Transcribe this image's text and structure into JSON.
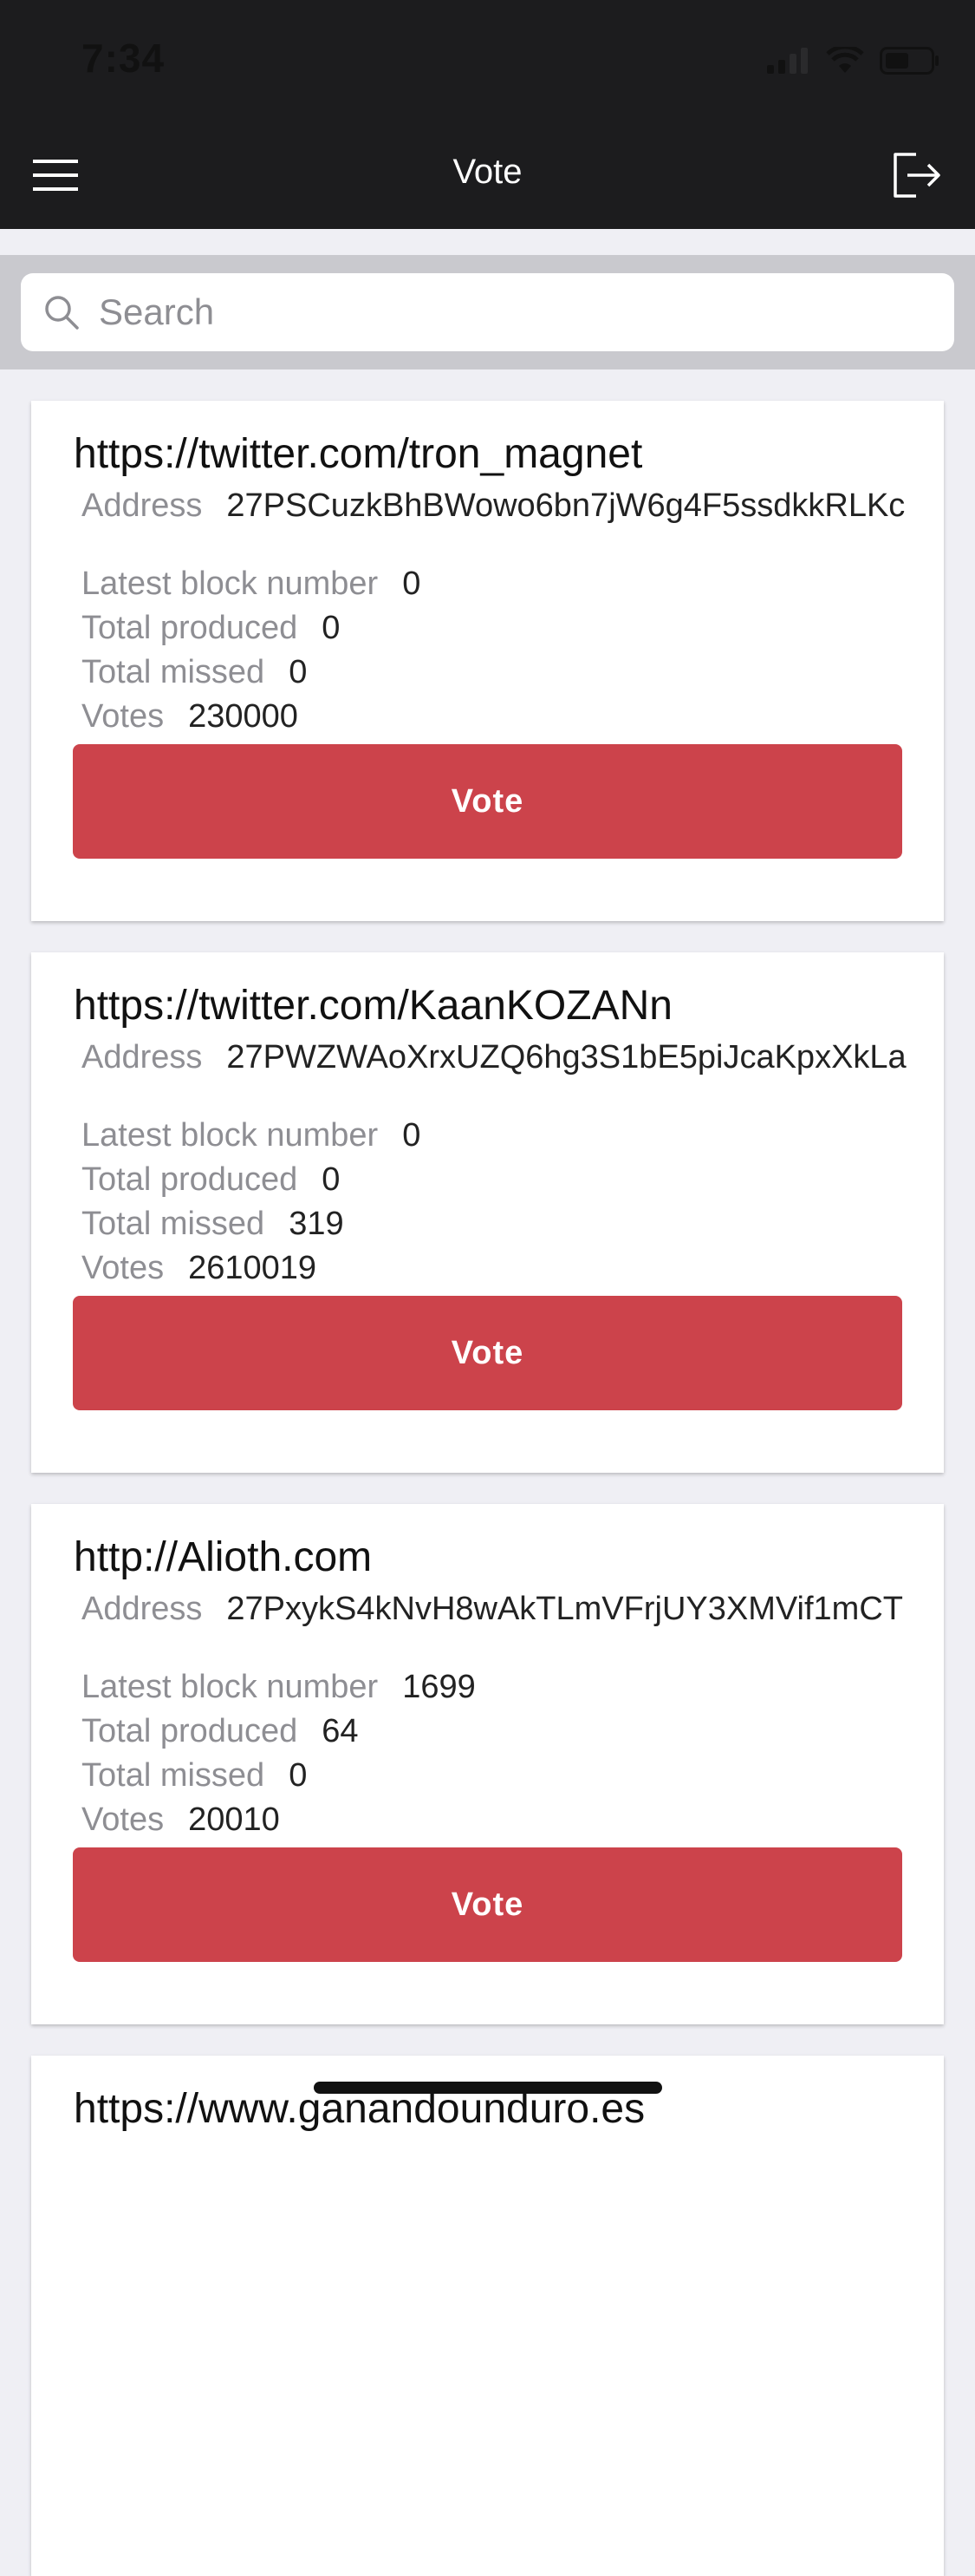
{
  "status_bar": {
    "time": "7:34"
  },
  "header": {
    "title": "Vote"
  },
  "search": {
    "placeholder": "Search",
    "value": ""
  },
  "labels": {
    "address": "Address",
    "latest_block": "Latest block number",
    "total_produced": "Total produced",
    "total_missed": "Total missed",
    "votes": "Votes",
    "vote_button": "Vote"
  },
  "accent_color": "#cc434b",
  "witnesses": [
    {
      "url": "https://twitter.com/tron_magnet",
      "address": "27PSCuzkBhBWowo6bn7jW6g4F5ssdkkRLKc",
      "latest_block": "0",
      "total_produced": "0",
      "total_missed": "0",
      "votes": "230000"
    },
    {
      "url": "https://twitter.com/KaanKOZANn",
      "address": "27PWZWAoXrxUZQ6hg3S1bE5piJcaKpxXkLa",
      "latest_block": "0",
      "total_produced": "0",
      "total_missed": "319",
      "votes": "2610019"
    },
    {
      "url": "http://Alioth.com",
      "address": "27PxykS4kNvH8wAkTLmVFrjUY3XMVif1mCT",
      "latest_block": "1699",
      "total_produced": "64",
      "total_missed": "0",
      "votes": "20010"
    },
    {
      "url": "https://www.ganandounduro.es"
    }
  ]
}
